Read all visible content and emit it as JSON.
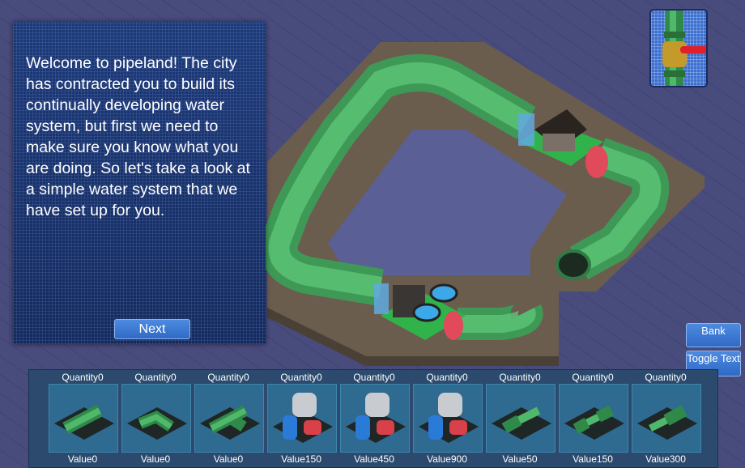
{
  "dialog": {
    "text": "Welcome to pipeland! The city has contracted you to build its continually developing water system, but first we need to make sure you know what you are doing. So let's take a look at a simple water system that we have set up for you.",
    "next_label": "Next"
  },
  "side_buttons": {
    "bank_label": "Bank",
    "toggle_label": "Toggle Text"
  },
  "valve_icon": "valve-icon",
  "shop": {
    "items": [
      {
        "quantity": "Quantity0",
        "value": "Value0",
        "icon": "straight-pipe-icon"
      },
      {
        "quantity": "Quantity0",
        "value": "Value0",
        "icon": "elbow-pipe-icon"
      },
      {
        "quantity": "Quantity0",
        "value": "Value0",
        "icon": "tee-pipe-icon"
      },
      {
        "quantity": "Quantity0",
        "value": "Value150",
        "icon": "pump-icon"
      },
      {
        "quantity": "Quantity0",
        "value": "Value450",
        "icon": "pump-icon"
      },
      {
        "quantity": "Quantity0",
        "value": "Value900",
        "icon": "pump-icon"
      },
      {
        "quantity": "Quantity0",
        "value": "Value50",
        "icon": "reducer-pipe-icon"
      },
      {
        "quantity": "Quantity0",
        "value": "Value150",
        "icon": "reducer-pipe-icon"
      },
      {
        "quantity": "Quantity0",
        "value": "Value300",
        "icon": "reducer-pipe-icon"
      }
    ]
  },
  "colors": {
    "pipe_green": "#4fb86a",
    "panel_blue": "#1d3a78",
    "button_blue": "#3a78d4",
    "valve_red": "#e0202a"
  }
}
